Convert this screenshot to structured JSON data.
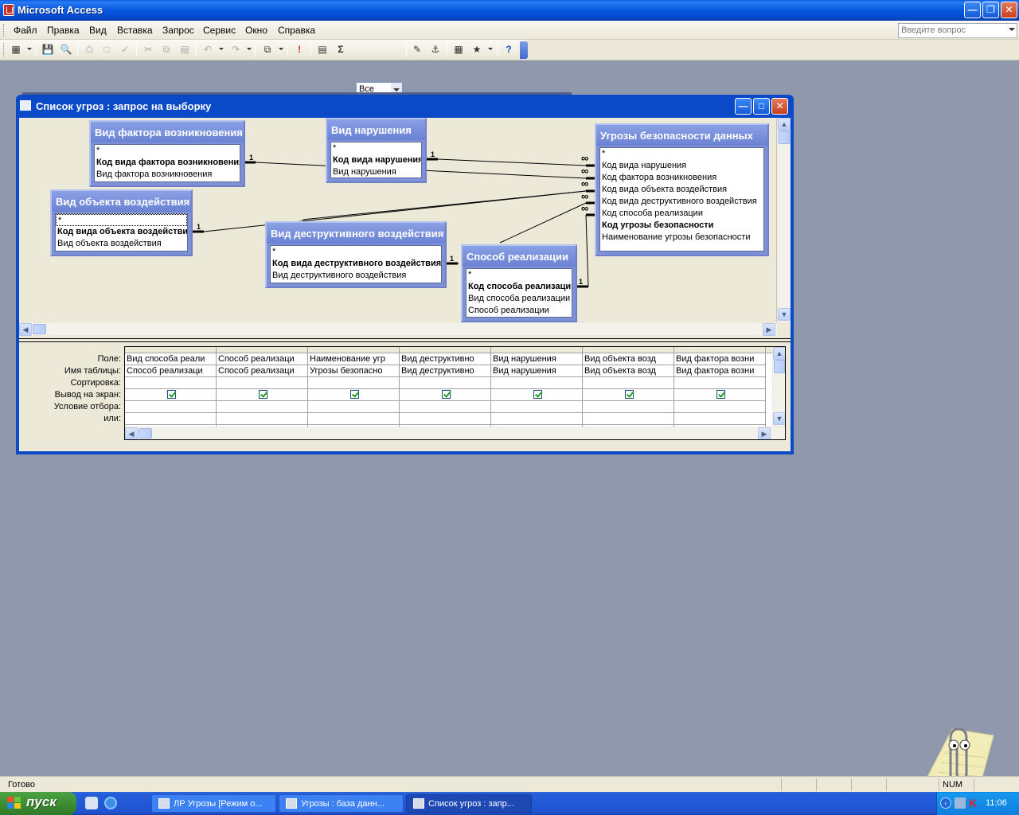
{
  "app": {
    "title": "Microsoft Access",
    "caption_buttons": [
      "minimize",
      "restore",
      "close"
    ]
  },
  "menu": {
    "items": [
      "Файл",
      "Правка",
      "Вид",
      "Вставка",
      "Запрос",
      "Сервис",
      "Окно",
      "Справка"
    ],
    "help_placeholder": "Введите вопрос"
  },
  "toolbar": {
    "icons": [
      "view-icon",
      "save-icon",
      "print-preview-icon",
      "print-icon",
      "preview-icon",
      "spelling-icon",
      "cut-icon",
      "copy-icon",
      "paste-icon",
      "undo-icon",
      "redo-icon",
      "query-type-icon",
      "run-icon",
      "show-table-icon",
      "totals-icon",
      "properties-icon",
      "build-icon",
      "database-window-icon",
      "new-object-icon",
      "help-icon"
    ],
    "top_values": "Все"
  },
  "query_window": {
    "title": "Список угроз : запрос на выборку",
    "tables": [
      {
        "title": "Вид фактора возникновения",
        "fields": [
          {
            "name": "*",
            "pk": false
          },
          {
            "name": "Код вида фактора возникновения",
            "pk": true
          },
          {
            "name": "Вид фактора возникновения",
            "pk": false
          }
        ]
      },
      {
        "title": "Вид нарушения",
        "fields": [
          {
            "name": "*",
            "pk": false
          },
          {
            "name": "Код вида нарушения",
            "pk": true
          },
          {
            "name": "Вид нарушения",
            "pk": false
          }
        ]
      },
      {
        "title": "Угрозы безопасности данных",
        "fields": [
          {
            "name": "*",
            "pk": false
          },
          {
            "name": "Код вида нарушения",
            "pk": false
          },
          {
            "name": "Код фактора возникновения",
            "pk": false
          },
          {
            "name": "Код вида объекта воздействия",
            "pk": false
          },
          {
            "name": "Код вида деструктивного воздействия",
            "pk": false
          },
          {
            "name": "Код способа реализации",
            "pk": false
          },
          {
            "name": "Код угрозы безопасности",
            "pk": true
          },
          {
            "name": "Наименование угрозы безопасности",
            "pk": false
          }
        ]
      },
      {
        "title": "Вид объекта воздействия",
        "fields": [
          {
            "name": "*",
            "pk": false
          },
          {
            "name": "Код вида объекта воздействия",
            "pk": true
          },
          {
            "name": "Вид объекта воздействия",
            "pk": false
          }
        ]
      },
      {
        "title": "Вид деструктивного воздействия",
        "fields": [
          {
            "name": "*",
            "pk": false
          },
          {
            "name": "Код вида деструктивного воздействия",
            "pk": true
          },
          {
            "name": "Вид деструктивного воздействия",
            "pk": false
          }
        ]
      },
      {
        "title": "Способ реализации",
        "fields": [
          {
            "name": "*",
            "pk": false
          },
          {
            "name": "Код способа реализации",
            "pk": true
          },
          {
            "name": "Вид способа реализации",
            "pk": false
          },
          {
            "name": "Способ реализации",
            "pk": false
          }
        ]
      }
    ],
    "join_labels": {
      "one": "1",
      "many": "∞"
    },
    "grid": {
      "row_labels": [
        "Поле:",
        "Имя таблицы:",
        "Сортировка:",
        "Вывод на экран:",
        "Условие отбора:",
        "или:"
      ],
      "columns": [
        {
          "field": "Вид способа реали",
          "table": "Способ реализаци",
          "show": true
        },
        {
          "field": "Способ реализаци",
          "table": "Способ реализаци",
          "show": true
        },
        {
          "field": "Наименование угр",
          "table": "Угрозы безопасно",
          "show": true
        },
        {
          "field": "Вид деструктивно",
          "table": "Вид деструктивно",
          "show": true
        },
        {
          "field": "Вид нарушения",
          "table": "Вид нарушения",
          "show": true
        },
        {
          "field": "Вид объекта возд",
          "table": "Вид объекта возд",
          "show": true
        },
        {
          "field": "Вид фактора возни",
          "table": "Вид фактора возни",
          "show": true
        }
      ]
    }
  },
  "status": {
    "text": "Готово",
    "num": "NUM"
  },
  "taskbar": {
    "start": "пуск",
    "tasks": [
      {
        "label": "ЛР Угрозы [Режим о...",
        "active": false
      },
      {
        "label": "Угрозы : база данн...",
        "active": false
      },
      {
        "label": "Список угроз : запр...",
        "active": true
      }
    ],
    "clock": "11:06"
  }
}
